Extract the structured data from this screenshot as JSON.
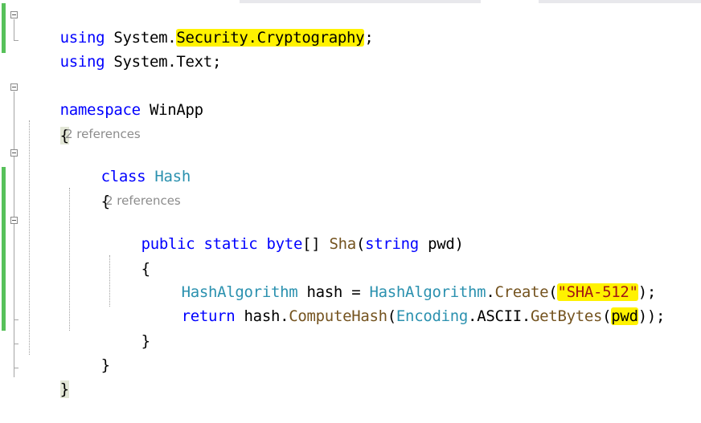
{
  "editor": {
    "using1": {
      "kw": "using",
      "ns_a": "System.",
      "ns_b": "Security.Cryptography",
      "end": ";"
    },
    "using2": {
      "kw": "using",
      "ns": "System.Text",
      "end": ";"
    },
    "namespace": {
      "kw": "namespace",
      "name": "WinApp"
    },
    "open_brace": "{",
    "close_brace": "}",
    "class_refs": "2 references",
    "class_decl": {
      "kw": "class",
      "name": "Hash"
    },
    "class_open": "{",
    "class_close": "}",
    "method_refs": "2 references",
    "method_decl": {
      "public": "public",
      "static": "static",
      "byte": "byte",
      "arr": "[]",
      "name": "Sha",
      "lp": "(",
      "string": "string",
      "param": "pwd",
      "rp": ")"
    },
    "method_open": "{",
    "method_close": "}",
    "stmt1": {
      "type": "HashAlgorithm",
      "var": "hash",
      "eq": "=",
      "cls": "HashAlgorithm",
      "dot": ".",
      "create": "Create",
      "lp": "(",
      "str": "\"SHA-512\"",
      "rp": ");"
    },
    "stmt2": {
      "ret": "return",
      "var": "hash",
      "dot1": ".",
      "compute": "ComputeHash",
      "lp1": "(",
      "enc": "Encoding",
      "dot2": ".",
      "ascii": "ASCII",
      "dot3": ".",
      "getbytes": "GetBytes",
      "lp2": "(",
      "param": "pwd",
      "rp": "));"
    }
  },
  "colors": {
    "keyword": "#0000ff",
    "type": "#2b91af",
    "method": "#74531f",
    "string": "#a31515",
    "highlight": "#fff200",
    "change_bar": "#57c15a"
  }
}
